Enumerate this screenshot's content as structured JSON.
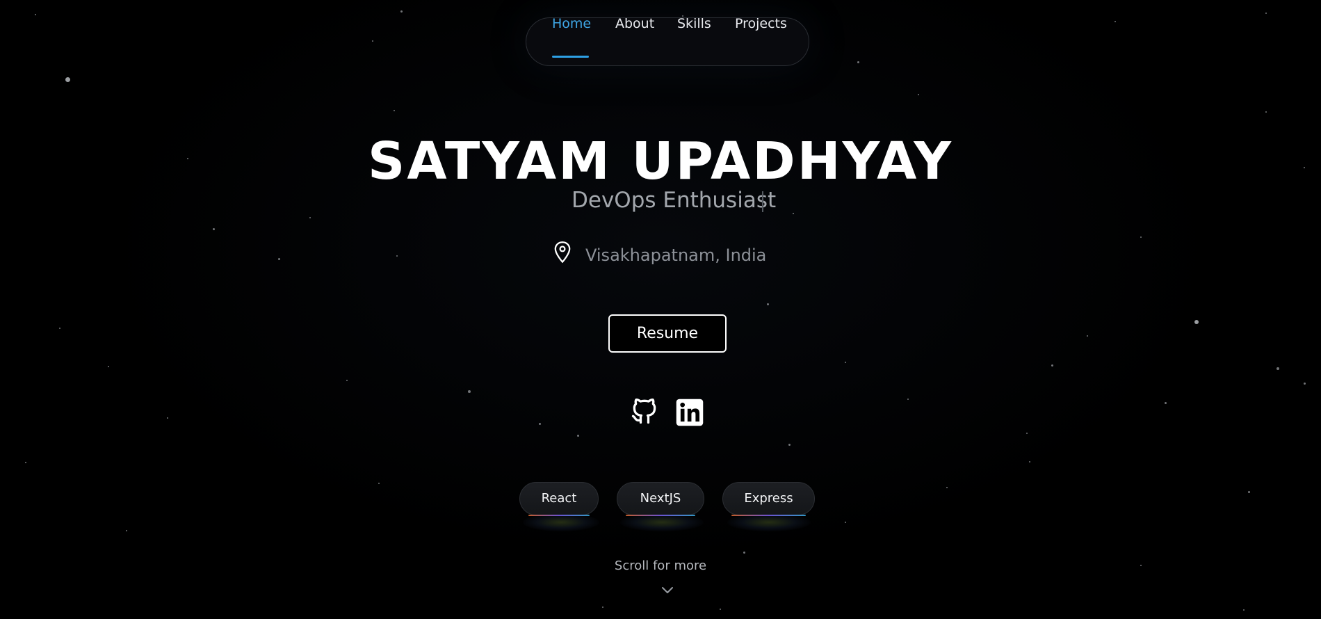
{
  "nav": {
    "items": [
      {
        "label": "Home",
        "active": true
      },
      {
        "label": "About",
        "active": false
      },
      {
        "label": "Skills",
        "active": false
      },
      {
        "label": "Projects",
        "active": false
      }
    ],
    "active_color": "#3fa7e6"
  },
  "hero": {
    "name": "SATYAM UPADHYAY",
    "role": "DevOps Enthusiast",
    "location": "Visakhapatnam, India"
  },
  "buttons": {
    "resume_label": "Resume"
  },
  "social": {
    "icons": [
      "github-icon",
      "linkedin-icon"
    ]
  },
  "tech_pills": [
    {
      "label": "React"
    },
    {
      "label": "NextJS"
    },
    {
      "label": "Express"
    }
  ],
  "scroll": {
    "label": "Scroll for more",
    "icon": "chevron-down-icon"
  },
  "colors": {
    "background": "#000000",
    "accent": "#2ea0e4",
    "muted_text": "#a3a7ad"
  }
}
